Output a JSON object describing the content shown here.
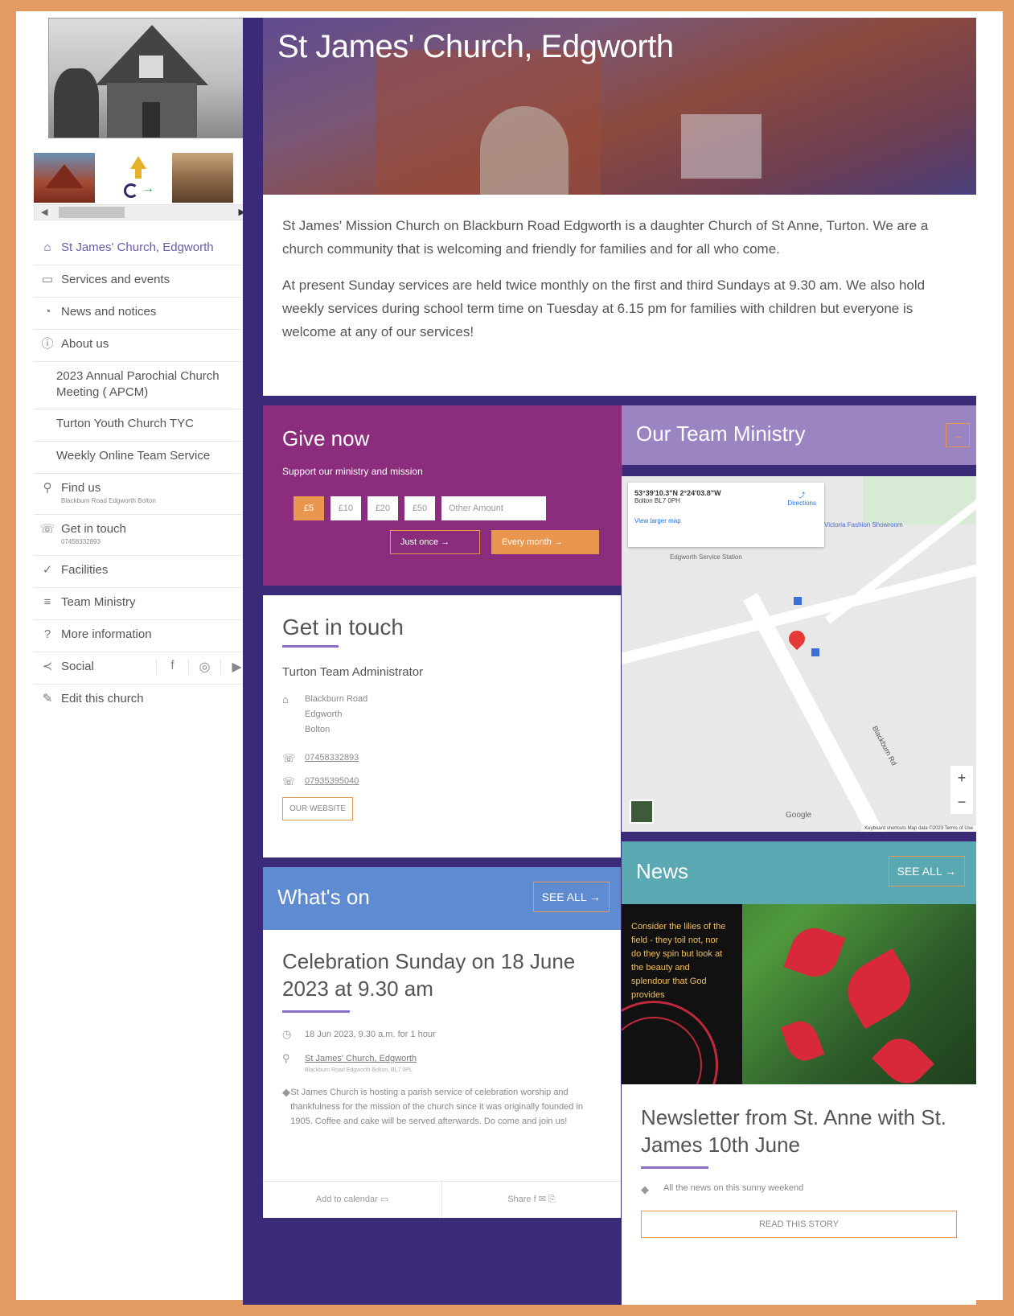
{
  "hero": {
    "title": "St James' Church, Edgworth"
  },
  "sidebar": {
    "thumb_scroll": {
      "left": "◀",
      "right": "▶"
    },
    "items": [
      {
        "label": "St James' Church, Edgworth",
        "icon": "home-icon"
      },
      {
        "label": "Services and events",
        "icon": "calendar-icon"
      },
      {
        "label": "News and notices",
        "icon": "megaphone-icon"
      },
      {
        "label": "About us",
        "icon": "info-icon"
      },
      {
        "label": "2023 Annual Parochial Church Meeting ( APCM)"
      },
      {
        "label": "Turton Youth Church TYC"
      },
      {
        "label": "Weekly Online Team Service"
      },
      {
        "label": "Find us",
        "sub": "Blackburn Road Edgworth Bolton",
        "icon": "location-pin-icon"
      },
      {
        "label": "Get in touch",
        "sub": "07458332893",
        "icon": "phone-icon"
      },
      {
        "label": "Facilities",
        "icon": "check-circle-icon"
      },
      {
        "label": "Team Ministry",
        "icon": "list-circle-icon"
      },
      {
        "label": "More information",
        "icon": "question-icon"
      },
      {
        "label": "Social",
        "icon": "share-icon"
      },
      {
        "label": "Edit this church",
        "icon": "pencil-icon"
      }
    ]
  },
  "intro": {
    "p1": "St James' Mission Church on Blackburn Road Edgworth is a daughter Church of St Anne, Turton. We are a church community that is welcoming and friendly for families and for all who come.",
    "p2": "At present Sunday services are held twice monthly on the first and third Sundays at 9.30 am. We also hold weekly services during school term time on Tuesday at 6.15 pm for families with children but everyone is welcome at any of our services!"
  },
  "give": {
    "title": "Give now",
    "subtitle": "Support our ministry and mission",
    "amounts": [
      "£5",
      "£10",
      "£20",
      "£50"
    ],
    "other_placeholder": "Other Amount",
    "once_label": "Just once →",
    "month_label": "Every month →"
  },
  "team": {
    "title": "Our Team Ministry",
    "arrow": "→"
  },
  "map": {
    "coords": "53°39'10.3\"N 2°24'03.8\"W",
    "place": "Bolton BL7 0PH",
    "directions": "Directions",
    "larger": "View larger map",
    "poi": "Victoria Fashion Showroom",
    "station": "Edgworth Service Station",
    "road": "Blackburn Rd",
    "zoom_in": "+",
    "zoom_out": "−",
    "google": "Google",
    "attribution": "Keyboard shortcuts  Map data ©2023  Terms of Use"
  },
  "touch": {
    "title": "Get in touch",
    "admin": "Turton Team Administrator",
    "address": [
      "Blackburn Road",
      "Edgworth",
      "Bolton"
    ],
    "phone1": "07458332893",
    "phone2": "07935395040",
    "website": "OUR WEBSITE"
  },
  "whats": {
    "title": "What's on",
    "see_all": "SEE ALL →"
  },
  "event": {
    "title": "Celebration Sunday on 18 June 2023 at 9.30 am",
    "when": "18 Jun 2023, 9.30 a.m. for 1 hour",
    "where": "St James' Church, Edgworth",
    "where_sub": "Blackburn Road Edgworth Bolton, BL7 0PL",
    "desc": "St James Church is hosting a parish service of celebration worship and thankfulness for the mission of the church since it was originally founded in 1905. Coffee and cake will be served afterwards. Do come and join us!",
    "add_calendar": "Add to calendar",
    "share": "Share"
  },
  "news": {
    "title": "News",
    "see_all": "SEE ALL →",
    "quote": "Consider the lilies of the field - they toil not, nor do they spin but look at the beauty and splendour that God provides",
    "story_title": "Newsletter from St. Anne with St. James 10th June",
    "story_desc": "All the news on this sunny weekend",
    "read": "READ THIS STORY"
  },
  "colors": {
    "frame": "#e39a63",
    "purple_bg": "#3a2a78",
    "give": "#8b2c7c",
    "team": "#9b84c2",
    "whats": "#5f8bd0",
    "news": "#5aa8b2",
    "accent": "#e9974f"
  }
}
